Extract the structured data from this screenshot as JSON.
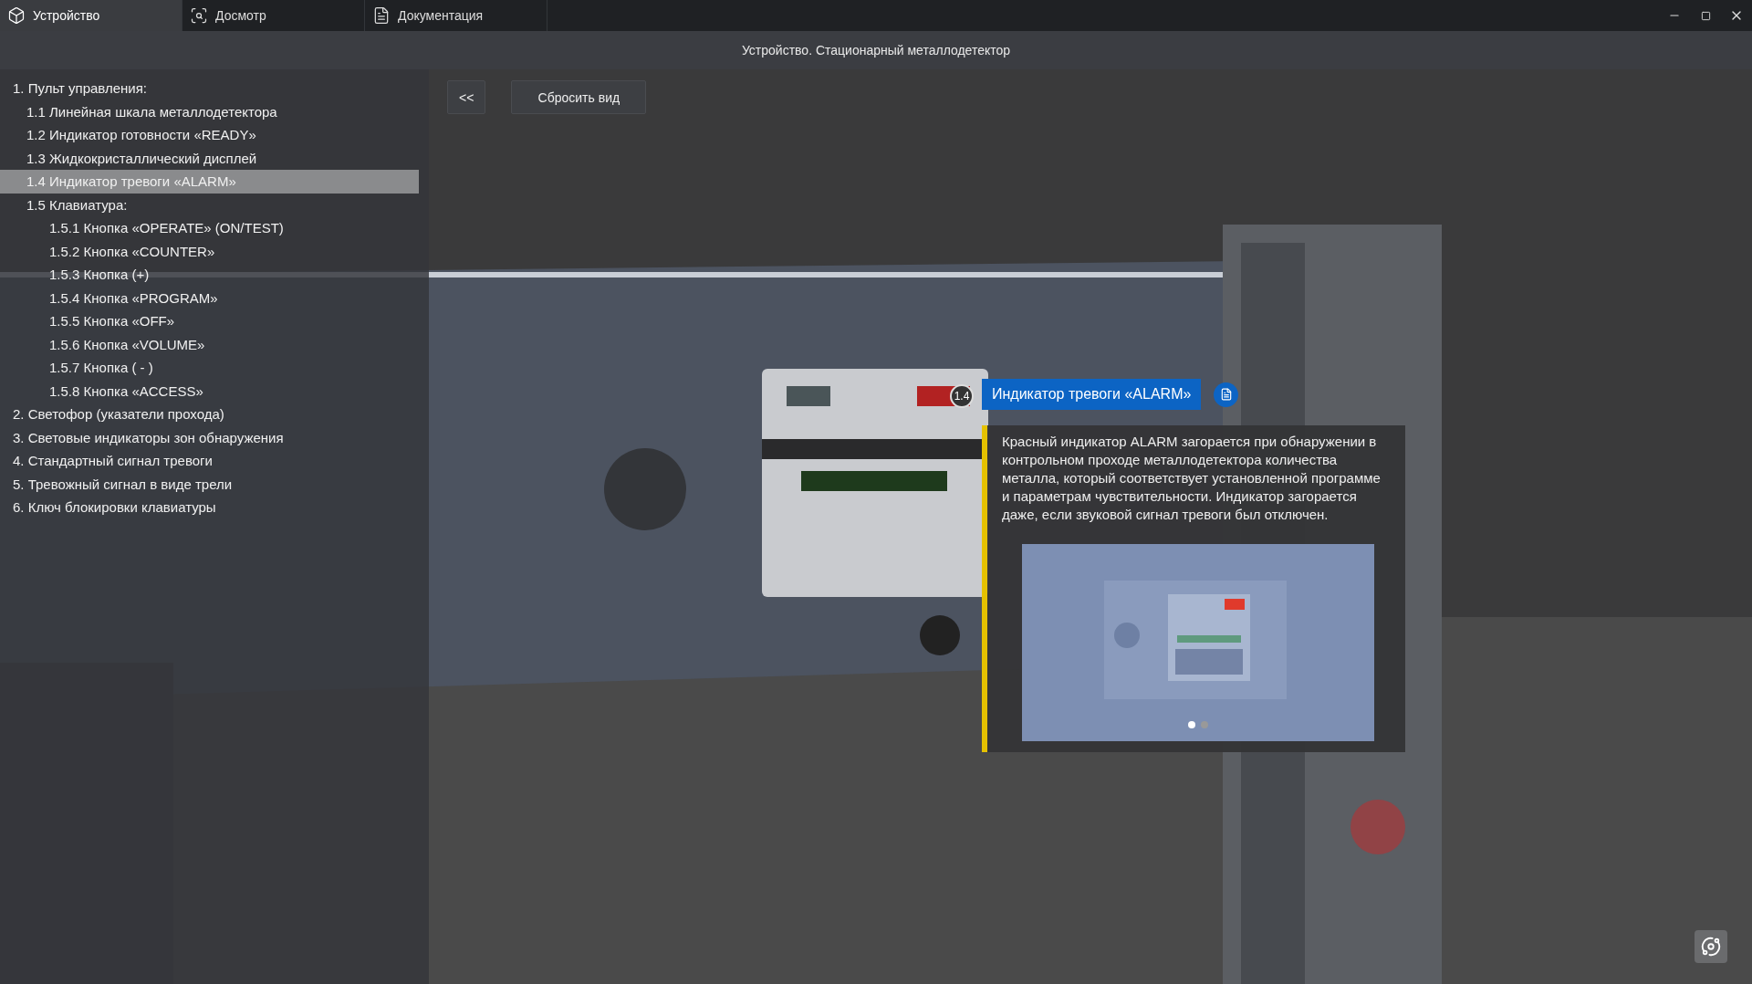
{
  "tabs": [
    {
      "label": "Устройство",
      "kind": "cube",
      "selected": true
    },
    {
      "label": "Досмотр",
      "kind": "cube-search",
      "selected": false
    },
    {
      "label": "Документация",
      "kind": "document",
      "selected": false
    }
  ],
  "header": {
    "title": "Устройство. Стационарный металлодетектор"
  },
  "sidebar": {
    "items": [
      {
        "number": "1.",
        "label": "Пульт управления:",
        "selected": false,
        "children": [
          {
            "number": "1.1",
            "label": "Линейная шкала металлодетектора",
            "selected": false
          },
          {
            "number": "1.2",
            "label": "Индикатор готовности «READY»",
            "selected": false
          },
          {
            "number": "1.3",
            "label": "Жидкокристаллический дисплей",
            "selected": false
          },
          {
            "number": "1.4",
            "label": "Индикатор тревоги «ALARM»",
            "selected": true
          },
          {
            "number": "1.5",
            "label": "Клавиатура:",
            "selected": false,
            "children": [
              {
                "number": "1.5.1",
                "label": "Кнопка «OPERATE» (ON/TEST)",
                "selected": false
              },
              {
                "number": "1.5.2",
                "label": "Кнопка «COUNTER»",
                "selected": false
              },
              {
                "number": "1.5.3",
                "label": "Кнопка (+)",
                "selected": false
              },
              {
                "number": "1.5.4",
                "label": "Кнопка «PROGRAM»",
                "selected": false
              },
              {
                "number": "1.5.5",
                "label": "Кнопка «OFF»",
                "selected": false
              },
              {
                "number": "1.5.6",
                "label": "Кнопка «VOLUME»",
                "selected": false
              },
              {
                "number": "1.5.7",
                "label": "Кнопка ( - )",
                "selected": false
              },
              {
                "number": "1.5.8",
                "label": "Кнопка «ACCESS»",
                "selected": false
              }
            ]
          }
        ]
      },
      {
        "number": "2.",
        "label": "Светофор (указатели прохода)",
        "selected": false
      },
      {
        "number": "3.",
        "label": "Световые индикаторы зон обнаружения",
        "selected": false
      },
      {
        "number": "4.",
        "label": "Стандартный сигнал тревоги",
        "selected": false
      },
      {
        "number": "5.",
        "label": "Тревожный сигнал в виде трели",
        "selected": false
      },
      {
        "number": "6.",
        "label": "Ключ блокировки клавиатуры",
        "selected": false
      }
    ]
  },
  "toolbar": {
    "collapse": "<<",
    "reset": "Сбросить вид"
  },
  "viewport": {
    "kind": "picture",
    "marker": "1.4"
  },
  "callout": {
    "title": "Индикатор тревоги «ALARM»",
    "text": "Красный индикатор ALARM загорается при обнаружении в контрольном проходе металлодетектора количества металла, который соответствует установленной программе и параметрам чувствительности. Индикатор загорается даже, если звуковой сигнал тревоги был отключен.",
    "dots": [
      {
        "selected": true
      },
      {
        "selected": false
      }
    ]
  }
}
